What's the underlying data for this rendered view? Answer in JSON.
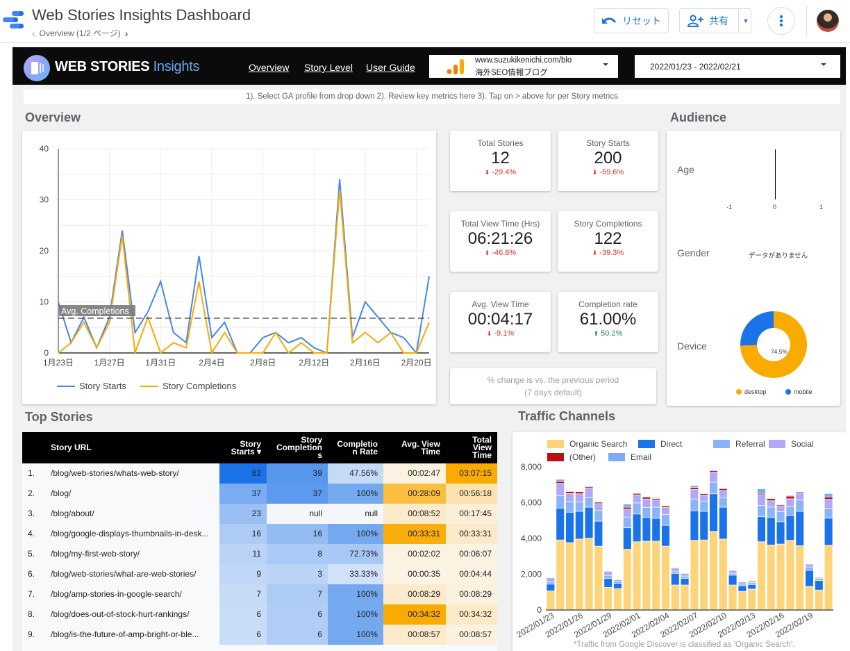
{
  "app": {
    "title": "Web Stories Insights Dashboard",
    "page_indicator": "Overview (1/2 ページ)",
    "reset_label": "リセット",
    "share_label": "共有"
  },
  "banner": {
    "brand_bold": "WEB STORIES",
    "brand_light": "Insights",
    "nav": [
      "Overview",
      "Story Level",
      "User Guide"
    ],
    "ga_profile": {
      "line1": "www.suzukikenichi.com/blo",
      "line2": "海外SEO情報ブログ"
    },
    "date_range": "2022/01/23 - 2022/02/21",
    "instructions": "1). Select GA profile from drop down 2). Review key metrics here 3). Tap on > above for per Story metrics"
  },
  "sections": {
    "overview": "Overview",
    "audience": "Audience",
    "top_stories": "Top Stories",
    "traffic": "Traffic Channels"
  },
  "kpis": [
    {
      "label": "Total Stories",
      "value": "12",
      "change": "-29.4%",
      "direction": "down"
    },
    {
      "label": "Story Starts",
      "value": "200",
      "change": "-59.6%",
      "direction": "down"
    },
    {
      "label": "Total View Time (Hrs)",
      "value": "06:21:26",
      "change": "-46.8%",
      "direction": "down"
    },
    {
      "label": "Story Completions",
      "value": "122",
      "change": "-39.3%",
      "direction": "down"
    },
    {
      "label": "Avg. View Time",
      "value": "00:04:17",
      "change": "-9.1%",
      "direction": "down"
    },
    {
      "label": "Completion rate",
      "value": "61.00%",
      "change": "50.2%",
      "direction": "up"
    }
  ],
  "kpi_note": {
    "line1": "% change is vs. the previous period",
    "line2": "(7 days default)"
  },
  "audience": {
    "age_label": "Age",
    "age_ticks": [
      "-1",
      "0",
      "1"
    ],
    "gender_label": "Gender",
    "gender_empty": "データがありません",
    "device_label": "Device",
    "device_center_label": "74.5%",
    "device_legend": [
      "desktop",
      "mobile"
    ]
  },
  "table": {
    "headers": {
      "url": "Story URL",
      "starts": [
        "Story",
        "Starts ▾"
      ],
      "completions": [
        "Story",
        "Completion",
        "s"
      ],
      "rate": [
        "Completio",
        "n Rate"
      ],
      "avg": [
        "Avg. View",
        "Time"
      ],
      "total": [
        "Total",
        "View",
        "Time"
      ]
    },
    "rows": [
      {
        "n": "1.",
        "url": "/blog/web-stories/whats-web-story/",
        "starts": "82",
        "completions": "39",
        "rate": "47.56%",
        "avg": "00:02:47",
        "total": "03:07:15"
      },
      {
        "n": "2.",
        "url": "/blog/",
        "starts": "37",
        "completions": "37",
        "rate": "100%",
        "avg": "00:28:09",
        "total": "00:56:18"
      },
      {
        "n": "3.",
        "url": "/blog/about/",
        "starts": "23",
        "completions": "null",
        "rate": "null",
        "avg": "00:08:52",
        "total": "00:17:45"
      },
      {
        "n": "4.",
        "url": "/blog/google-displays-thumbnails-in-desk...",
        "starts": "16",
        "completions": "16",
        "rate": "100%",
        "avg": "00:33:31",
        "total": "00:33:31"
      },
      {
        "n": "5.",
        "url": "/blog/my-first-web-story/",
        "starts": "11",
        "completions": "8",
        "rate": "72.73%",
        "avg": "00:02:02",
        "total": "00:06:07"
      },
      {
        "n": "6.",
        "url": "/blog/web-stories/what-are-web-stories/",
        "starts": "9",
        "completions": "3",
        "rate": "33.33%",
        "avg": "00:00:35",
        "total": "00:04:44"
      },
      {
        "n": "7.",
        "url": "/blog/amp-stories-in-google-search/",
        "starts": "7",
        "completions": "7",
        "rate": "100%",
        "avg": "00:08:29",
        "total": "00:08:29"
      },
      {
        "n": "8.",
        "url": "/blog/does-out-of-stock-hurt-rankings/",
        "starts": "6",
        "completions": "6",
        "rate": "100%",
        "avg": "00:34:32",
        "total": "00:34:32"
      },
      {
        "n": "9.",
        "url": "/blog/is-the-future-of-amp-bright-or-ble...",
        "starts": "6",
        "completions": "6",
        "rate": "100%",
        "avg": "00:08:57",
        "total": "00:08:57"
      }
    ]
  },
  "traffic_footnote": "*Traffic from Google Discover is classified as 'Organic Search'.",
  "colors": {
    "blue": "#1a73e8",
    "orange": "#f9ab00",
    "organic": "#fdd47a",
    "direct": "#1a73e8",
    "referral": "#8ab4f8",
    "social": "#b1a9f8",
    "other": "#b31412",
    "email": "#7baaf7"
  },
  "chart_data": [
    {
      "type": "line",
      "title": "Overview",
      "x": [
        "1月23日",
        "1月24日",
        "1月25日",
        "1月26日",
        "1月27日",
        "1月28日",
        "1月29日",
        "1月30日",
        "1月31日",
        "2月1日",
        "2月2日",
        "2月3日",
        "2月4日",
        "2月5日",
        "2月6日",
        "2月7日",
        "2月8日",
        "2月9日",
        "2月10日",
        "2月11日",
        "2月12日",
        "2月13日",
        "2月14日",
        "2月15日",
        "2月16日",
        "2月17日",
        "2月18日",
        "2月19日",
        "2月20日",
        "2月21日"
      ],
      "xticks": [
        "1月23日",
        "1月27日",
        "1月31日",
        "2月4日",
        "2月8日",
        "2月12日",
        "2月16日",
        "2月20日"
      ],
      "ylim": [
        0,
        40
      ],
      "yticks": [
        0,
        10,
        20,
        30,
        40
      ],
      "series": [
        {
          "name": "Story Starts",
          "color": "#4285f4",
          "values": [
            10,
            2,
            7,
            1,
            7,
            24,
            4,
            8,
            14,
            4,
            2,
            19,
            3,
            6,
            0,
            0,
            3,
            4,
            2,
            3,
            1,
            0,
            34,
            3,
            10,
            7,
            4,
            3,
            0,
            15
          ]
        },
        {
          "name": "Story Completions",
          "color": "#f9ab00",
          "values": [
            0,
            2,
            6,
            1,
            6,
            23,
            0,
            7,
            0,
            2,
            1,
            14,
            0,
            4,
            0,
            0,
            0,
            4,
            0,
            2,
            0,
            0,
            32,
            2,
            4,
            2,
            4,
            0,
            0,
            6
          ]
        }
      ],
      "reference_line": {
        "label": "Avg. Completions",
        "value": 6.8
      },
      "legend": "bottom-left",
      "grid": true
    },
    {
      "type": "pie",
      "title": "Device",
      "categories": [
        "desktop",
        "mobile"
      ],
      "values": [
        74.5,
        25.5
      ],
      "colors": [
        "#f9ab00",
        "#1a73e8"
      ],
      "donut": true
    },
    {
      "type": "bar",
      "stacked": true,
      "title": "Traffic Channels",
      "categories": [
        "2022/01/23",
        "2022/01/24",
        "2022/01/25",
        "2022/01/26",
        "2022/01/27",
        "2022/01/28",
        "2022/01/29",
        "2022/01/30",
        "2022/01/31",
        "2022/02/01",
        "2022/02/02",
        "2022/02/03",
        "2022/02/04",
        "2022/02/05",
        "2022/02/06",
        "2022/02/07",
        "2022/02/08",
        "2022/02/09",
        "2022/02/10",
        "2022/02/11",
        "2022/02/12",
        "2022/02/13",
        "2022/02/14",
        "2022/02/15",
        "2022/02/16",
        "2022/02/17",
        "2022/02/18",
        "2022/02/19",
        "2022/02/20",
        "2022/02/21"
      ],
      "xticks": [
        "2022/01/23",
        "2022/01/26",
        "2022/01/29",
        "2022/02/01",
        "2022/02/04",
        "2022/02/07",
        "2022/02/10",
        "2022/02/13",
        "2022/02/16",
        "2022/02/19"
      ],
      "ylim": [
        0,
        8000
      ],
      "yticks": [
        0,
        2000,
        4000,
        6000,
        8000
      ],
      "series": [
        {
          "name": "Organic Search",
          "values": [
            1050,
            3900,
            3750,
            3950,
            4000,
            3550,
            1250,
            1180,
            3380,
            3800,
            3830,
            3830,
            3550,
            1380,
            1380,
            3880,
            3900,
            4380,
            3950,
            1380,
            1020,
            1150,
            3800,
            3620,
            3670,
            3880,
            3580,
            1300,
            1100,
            3600
          ]
        },
        {
          "name": "Direct",
          "values": [
            380,
            1780,
            1700,
            1550,
            1730,
            1400,
            500,
            300,
            1200,
            1550,
            1330,
            1280,
            1170,
            650,
            370,
            1650,
            1600,
            2100,
            1780,
            550,
            320,
            260,
            1400,
            1540,
            1250,
            1380,
            1920,
            900,
            530,
            1520
          ]
        },
        {
          "name": "Referral",
          "values": [
            130,
            700,
            600,
            520,
            530,
            600,
            170,
            120,
            600,
            620,
            550,
            620,
            600,
            120,
            130,
            660,
            570,
            650,
            520,
            110,
            90,
            110,
            620,
            580,
            560,
            490,
            630,
            190,
            120,
            550
          ]
        },
        {
          "name": "Social",
          "values": [
            220,
            680,
            450,
            460,
            550,
            380,
            230,
            80,
            440,
            450,
            480,
            400,
            390,
            170,
            150,
            530,
            340,
            560,
            420,
            160,
            120,
            100,
            560,
            350,
            300,
            450,
            400,
            160,
            60,
            500
          ]
        },
        {
          "name": "(Other)",
          "values": [
            30,
            110,
            110,
            120,
            70,
            80,
            30,
            20,
            110,
            80,
            110,
            80,
            90,
            40,
            20,
            110,
            80,
            80,
            100,
            30,
            20,
            20,
            80,
            120,
            70,
            150,
            60,
            30,
            20,
            130
          ]
        },
        {
          "name": "Email",
          "values": [
            40,
            120,
            30,
            30,
            40,
            30,
            20,
            20,
            180,
            40,
            30,
            60,
            30,
            20,
            20,
            110,
            40,
            50,
            30,
            20,
            20,
            40,
            300,
            50,
            40,
            50,
            30,
            20,
            20,
            200
          ]
        }
      ],
      "legend": "top",
      "grid": false
    }
  ]
}
